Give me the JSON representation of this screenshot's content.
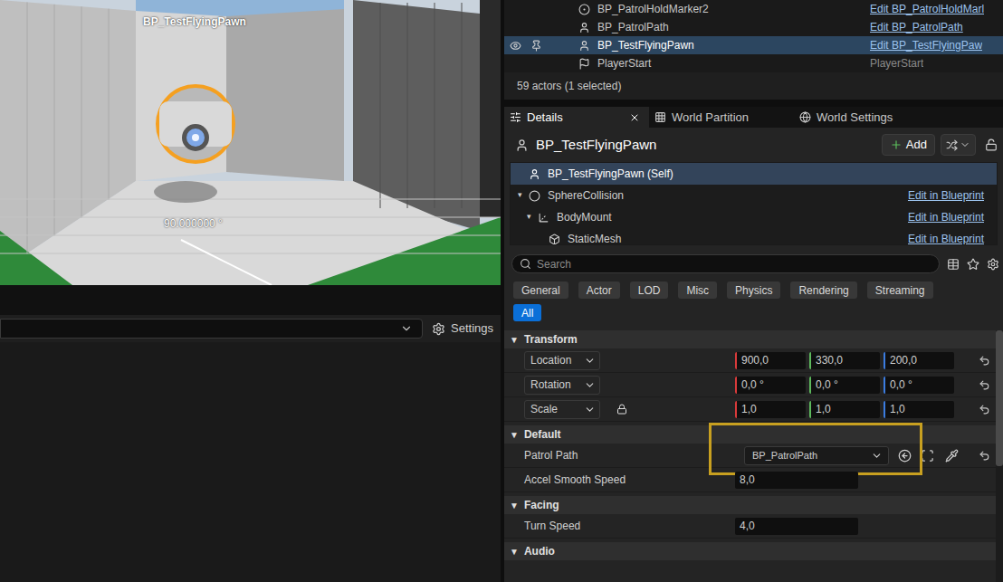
{
  "viewport": {
    "actor_label": "BP_TestFlyingPawn",
    "angle_readout": "90.000000 °"
  },
  "output_bar": {
    "settings": "Settings"
  },
  "outliner": {
    "rows": [
      {
        "name": "BP_PatrolHoldMarker2",
        "type": "Edit BP_PatrolHoldMarl",
        "link": true,
        "selected": false,
        "visible_icon": false
      },
      {
        "name": "BP_PatrolPath",
        "type": "Edit BP_PatrolPath",
        "link": true,
        "selected": false,
        "visible_icon": false
      },
      {
        "name": "BP_TestFlyingPawn",
        "type": "Edit BP_TestFlyingPaw",
        "link": true,
        "selected": true,
        "visible_icon": true
      },
      {
        "name": "PlayerStart",
        "type": "PlayerStart",
        "link": false,
        "selected": false,
        "visible_icon": false
      }
    ],
    "status": "59 actors (1 selected)"
  },
  "tabs": [
    {
      "label": "Details",
      "selected": true,
      "closable": true
    },
    {
      "label": "World Partition",
      "selected": false,
      "closable": false
    },
    {
      "label": "World Settings",
      "selected": false,
      "closable": false
    }
  ],
  "details": {
    "actor_name": "BP_TestFlyingPawn",
    "add_button": "Add",
    "locked": false,
    "components": [
      {
        "name": "BP_TestFlyingPawn (Self)",
        "selected": true,
        "depth": 0,
        "has_children": false,
        "expanded": false
      },
      {
        "name": "SphereCollision",
        "selected": false,
        "depth": 0,
        "has_children": true,
        "expanded": true,
        "link": "Edit in Blueprint"
      },
      {
        "name": "BodyMount",
        "selected": false,
        "depth": 1,
        "has_children": true,
        "expanded": true,
        "link": "Edit in Blueprint"
      },
      {
        "name": "StaticMesh",
        "selected": false,
        "depth": 2,
        "has_children": false,
        "expanded": false,
        "link": "Edit in Blueprint"
      }
    ],
    "search": {
      "placeholder": "Search"
    },
    "filters": [
      {
        "label": "General",
        "selected": false
      },
      {
        "label": "Actor",
        "selected": false
      },
      {
        "label": "LOD",
        "selected": false
      },
      {
        "label": "Misc",
        "selected": false
      },
      {
        "label": "Physics",
        "selected": false
      },
      {
        "label": "Rendering",
        "selected": false
      },
      {
        "label": "Streaming",
        "selected": false
      },
      {
        "label": "All",
        "selected": true
      }
    ],
    "sections": [
      {
        "title": "Transform",
        "expanded": true,
        "rows": [
          {
            "label": "Location",
            "kind": "vector",
            "dropdown": true,
            "values": [
              "900,0",
              "330,0",
              "200,0"
            ],
            "reset": true,
            "lock": false
          },
          {
            "label": "Rotation",
            "kind": "vector",
            "dropdown": true,
            "values": [
              "0,0 °",
              "0,0 °",
              "0,0 °"
            ],
            "reset": true,
            "lock": false
          },
          {
            "label": "Scale",
            "kind": "vector",
            "dropdown": true,
            "values": [
              "1,0",
              "1,0",
              "1,0"
            ],
            "reset": true,
            "lock": true
          }
        ]
      },
      {
        "title": "Default",
        "expanded": true,
        "rows": [
          {
            "label": "Patrol Path",
            "kind": "object",
            "value": "BP_PatrolPath",
            "reset": true,
            "highlighted": true
          },
          {
            "label": "Accel Smooth Speed",
            "kind": "number",
            "value": "8,0",
            "reset": false
          }
        ]
      },
      {
        "title": "Facing",
        "expanded": true,
        "rows": [
          {
            "label": "Turn Speed",
            "kind": "number",
            "value": "4,0",
            "reset": false
          }
        ]
      },
      {
        "title": "Audio",
        "expanded": true,
        "rows": []
      }
    ]
  }
}
